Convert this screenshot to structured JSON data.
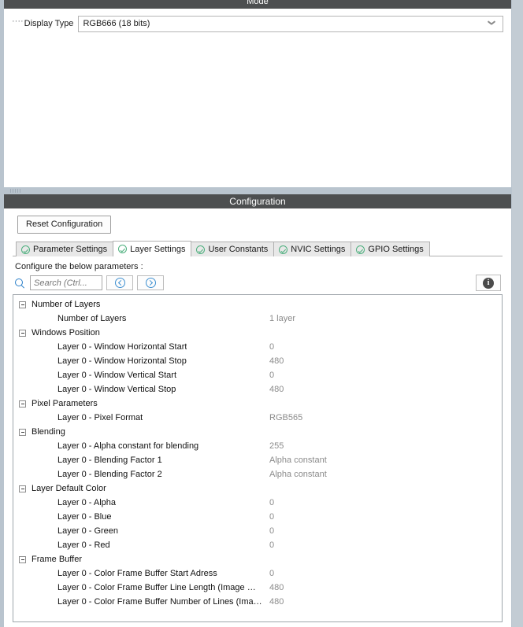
{
  "mode_panel": {
    "title": "Mode",
    "display_type": {
      "label": "Display Type",
      "value": "RGB666 (18 bits)",
      "chevron_icon": "chevron-down-icon",
      "leader": "····"
    }
  },
  "config_panel": {
    "title": "Configuration",
    "reset_button": "Reset Configuration",
    "tabs": [
      {
        "label": "Parameter Settings",
        "icon": "check-circle-icon",
        "active": false
      },
      {
        "label": "Layer Settings",
        "icon": "check-circle-icon",
        "active": true
      },
      {
        "label": "User Constants",
        "icon": "check-circle-icon",
        "active": false
      },
      {
        "label": "NVIC Settings",
        "icon": "check-circle-icon",
        "active": false
      },
      {
        "label": "GPIO Settings",
        "icon": "check-circle-icon",
        "active": false
      }
    ],
    "configure_note": "Configure the below parameters :",
    "search": {
      "icon": "search-icon",
      "placeholder": "Search (Ctrl...",
      "value": "",
      "prev_icon": "arrow-left-circle-icon",
      "next_icon": "arrow-right-circle-icon"
    },
    "info_icon": "info-icon",
    "tree": [
      {
        "group": "Number of Layers",
        "expanded": true,
        "rows": [
          {
            "name": "Number of Layers",
            "value": "1 layer"
          }
        ]
      },
      {
        "group": "Windows Position",
        "expanded": true,
        "rows": [
          {
            "name": "Layer 0 - Window Horizontal Start",
            "value": "0"
          },
          {
            "name": "Layer 0 - Window Horizontal Stop",
            "value": "480"
          },
          {
            "name": "Layer 0 - Window Vertical Start",
            "value": "0"
          },
          {
            "name": "Layer 0 - Window Vertical Stop",
            "value": "480"
          }
        ]
      },
      {
        "group": "Pixel Parameters",
        "expanded": true,
        "rows": [
          {
            "name": "Layer 0 - Pixel Format",
            "value": "RGB565"
          }
        ]
      },
      {
        "group": "Blending",
        "expanded": true,
        "rows": [
          {
            "name": "Layer 0 - Alpha constant for blending",
            "value": "255"
          },
          {
            "name": "Layer 0 - Blending Factor 1",
            "value": "Alpha constant"
          },
          {
            "name": "Layer 0 - Blending Factor 2",
            "value": "Alpha constant"
          }
        ]
      },
      {
        "group": "Layer Default Color",
        "expanded": true,
        "rows": [
          {
            "name": "Layer 0 - Alpha",
            "value": "0"
          },
          {
            "name": "Layer 0 - Blue",
            "value": "0"
          },
          {
            "name": "Layer 0 - Green",
            "value": "0"
          },
          {
            "name": "Layer 0 - Red",
            "value": "0"
          }
        ]
      },
      {
        "group": "Frame Buffer",
        "expanded": true,
        "rows": [
          {
            "name": "Layer 0 - Color Frame Buffer Start Adress",
            "value": "0"
          },
          {
            "name": "Layer 0 - Color Frame Buffer Line Length (Image Wi...",
            "value": "480"
          },
          {
            "name": "Layer 0 - Color Frame Buffer Number of Lines (Imag...",
            "value": "480"
          }
        ]
      }
    ]
  },
  "colors": {
    "titlebar": "#4d4f50",
    "panel_border": "#b9c4ce",
    "check_green": "#4caf7d",
    "accent_blue": "#2a7fc9",
    "value_gray": "#8b8b8b"
  }
}
